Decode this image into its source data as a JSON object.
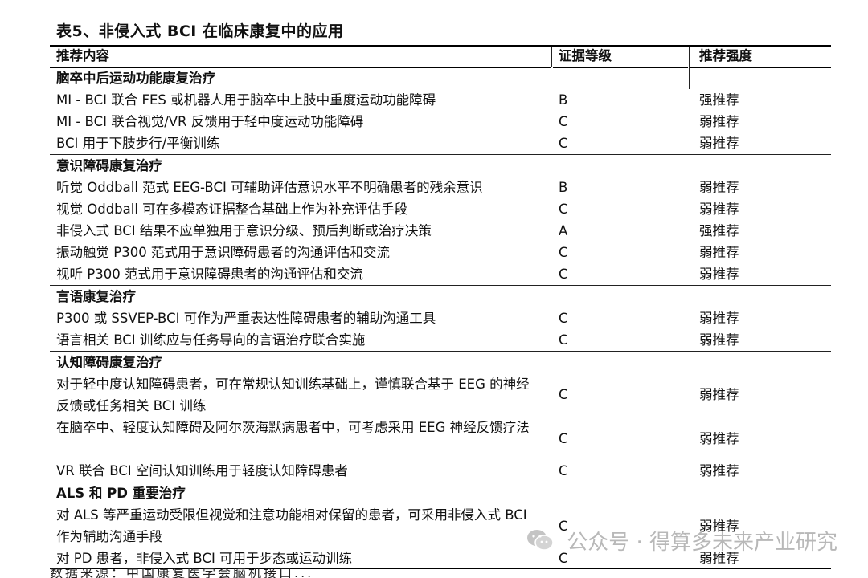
{
  "title": "表5、非侵入式 BCI 在临床康复中的应用",
  "headers": {
    "content": "推荐内容",
    "evidence": "证据等级",
    "strength": "推荐强度"
  },
  "sections": [
    {
      "name": "脑卒中后运动功能康复治疗",
      "rows": [
        {
          "content": "MI - BCI 联合 FES 或机器人用于脑卒中上肢中重度运动功能障碍",
          "evidence": "B",
          "strength": "强推荐"
        },
        {
          "content": "MI - BCI 联合视觉/VR 反馈用于轻中度运动功能障碍",
          "evidence": "C",
          "strength": "弱推荐"
        },
        {
          "content": "BCI 用于下肢步行/平衡训练",
          "evidence": "C",
          "strength": "弱推荐"
        }
      ]
    },
    {
      "name": "意识障碍康复治疗",
      "rows": [
        {
          "content": "听觉 Oddball 范式 EEG-BCI 可辅助评估意识水平不明确患者的残余意识",
          "evidence": "B",
          "strength": "弱推荐"
        },
        {
          "content": "视觉 Oddball 可在多模态证据整合基础上作为补充评估手段",
          "evidence": "C",
          "strength": "弱推荐"
        },
        {
          "content": "非侵入式 BCI 结果不应单独用于意识分级、预后判断或治疗决策",
          "evidence": "A",
          "strength": "强推荐"
        },
        {
          "content": "振动触觉 P300 范式用于意识障碍患者的沟通评估和交流",
          "evidence": "C",
          "strength": "弱推荐"
        },
        {
          "content": "视听 P300 范式用于意识障碍患者的沟通评估和交流",
          "evidence": "C",
          "strength": "弱推荐"
        }
      ]
    },
    {
      "name": "言语康复治疗",
      "rows": [
        {
          "content": "P300 或 SSVEP-BCI 可作为严重表达性障碍患者的辅助沟通工具",
          "evidence": "C",
          "strength": "弱推荐"
        },
        {
          "content": "语言相关 BCI 训练应与任务导向的言语治疗联合实施",
          "evidence": "C",
          "strength": "弱推荐"
        }
      ]
    },
    {
      "name": "认知障碍康复治疗",
      "rows": [
        {
          "content": "对于轻中度认知障碍患者，可在常规认知训练基础上，谨慎联合基于 EEG 的神经反馈或任务相关 BCI 训练",
          "evidence": "C",
          "strength": "弱推荐"
        },
        {
          "content": "在脑卒中、轻度认知障碍及阿尔茨海默病患者中，可考虑采用 EEG 神经反馈疗法",
          "evidence": "C",
          "strength": "弱推荐"
        },
        {
          "content": "VR 联合 BCI 空间认知训练用于轻度认知障碍患者",
          "evidence": "C",
          "strength": "弱推荐"
        }
      ]
    },
    {
      "name": "ALS 和 PD 重要治疗",
      "rows": [
        {
          "content": "对 ALS 等严重运动受限但视觉和注意功能相对保留的患者，可采用非侵入式 BCI 作为辅助沟通手段",
          "evidence": "C",
          "strength": "弱推荐"
        },
        {
          "content": "对 PD 患者，非侵入式 BCI 可用于步态或运动训练",
          "evidence": "C",
          "strength": "弱推荐"
        }
      ]
    }
  ],
  "watermark": "公众号 · 得算多未来产业研究",
  "watermark_icon": "wechat-icon",
  "footer_cut": "数据来源：中国康复医学会脑机接口..."
}
